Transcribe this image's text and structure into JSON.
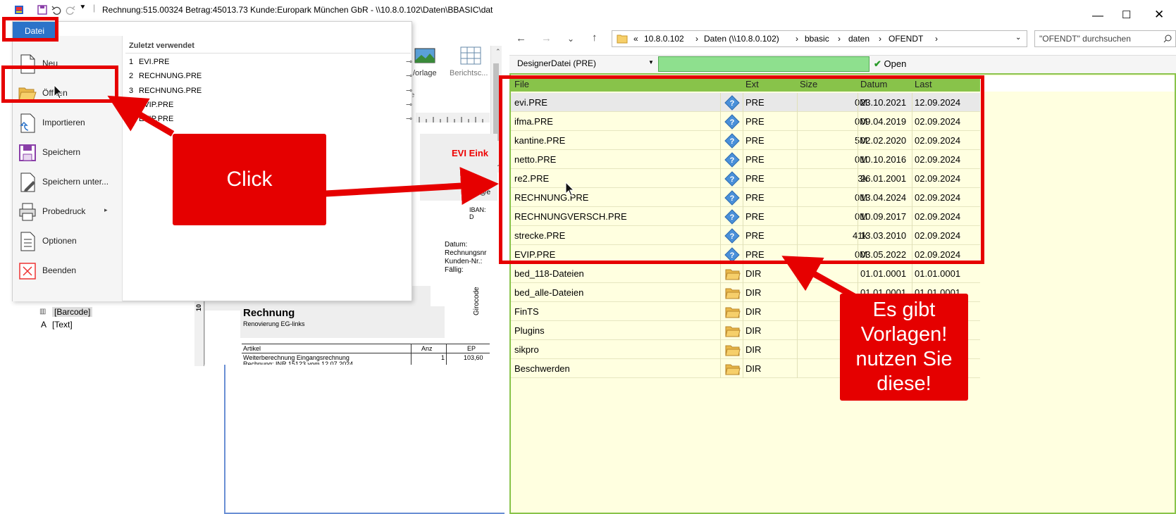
{
  "window": {
    "title": "Rechnung:515.00324 Betrag:45013.73 Kunde:Europark München GbR - \\\\10.8.0.102\\Daten\\BBASIC\\daten\\"
  },
  "ribbon": {
    "vorlage_label": "/orlage",
    "berichts_label": "Berichtsc..."
  },
  "background_doc": {
    "evi_header": "EVI Eink",
    "email_fragment": "il@e",
    "iban_fragment": "IBAN: D",
    "meta_labels": [
      "Datum:",
      "Rechnungsnr",
      "Kunden-Nr.:",
      "Fällig:"
    ],
    "invoice_title": "Rechnung",
    "invoice_subtitle": "Renovierung EG-links",
    "table_headers": [
      "Artikel",
      "Anz",
      "EP"
    ],
    "table_row": [
      "Weiterberechnung Eingangsrechnung",
      "1",
      "103,60"
    ],
    "table_row2": "Rechnung: INR 15123 vom 12.07.2024",
    "giro_label": "Girocode",
    "ruler_label": "10",
    "tree_items": [
      "[Barcode]",
      "[Text]"
    ],
    "tree_prefix": "A"
  },
  "file_menu": {
    "tab_label": "Datei",
    "items": [
      {
        "label": "Neu",
        "icon": "new-file-icon"
      },
      {
        "label": "Öffnen",
        "icon": "open-folder-icon"
      },
      {
        "label": "Importieren",
        "icon": "import-icon"
      },
      {
        "label": "Speichern",
        "icon": "save-icon"
      },
      {
        "label": "Speichern unter...",
        "icon": "save-as-icon"
      },
      {
        "label": "Probedruck",
        "icon": "printer-icon"
      },
      {
        "label": "Optionen",
        "icon": "options-icon"
      },
      {
        "label": "Beenden",
        "icon": "exit-icon"
      }
    ],
    "recent_header": "Zuletzt verwendet",
    "recent": [
      {
        "num": "1",
        "name": "EVI.PRE"
      },
      {
        "num": "2",
        "name": "RECHNUNG.PRE"
      },
      {
        "num": "3",
        "name": "RECHNUNG.PRE"
      },
      {
        "num": "4",
        "name": "EVIP.PRE"
      },
      {
        "num": "5",
        "name": "EVIP.PRE"
      }
    ]
  },
  "dialog": {
    "path": [
      "10.8.0.102",
      "Daten (\\\\10.8.0.102)",
      "bbasic",
      "daten",
      "OFENDT"
    ],
    "path_prefix": "«",
    "search_placeholder": "\"OFENDT\" durchsuchen",
    "filter_label": "DesignerDatei (PRE)",
    "filter_value": "",
    "open_label": "Open",
    "columns": [
      "File",
      "Ext",
      "Size",
      "Datum",
      "Last"
    ],
    "files": [
      {
        "name": "evi.PRE",
        "ext": "PRE",
        "size": "0M",
        "datum": "23.10.2021",
        "last": "12.09.2024",
        "type": "file"
      },
      {
        "name": "ifma.PRE",
        "ext": "PRE",
        "size": "0M",
        "datum": "09.04.2019",
        "last": "02.09.2024",
        "type": "file"
      },
      {
        "name": "kantine.PRE",
        "ext": "PRE",
        "size": "5M",
        "datum": "02.02.2020",
        "last": "02.09.2024",
        "type": "file"
      },
      {
        "name": "netto.PRE",
        "ext": "PRE",
        "size": "0M",
        "datum": "10.10.2016",
        "last": "02.09.2024",
        "type": "file"
      },
      {
        "name": "re2.PRE",
        "ext": "PRE",
        "size": "3k",
        "datum": "26.01.2001",
        "last": "02.09.2024",
        "type": "file"
      },
      {
        "name": "RECHNUNG.PRE",
        "ext": "PRE",
        "size": "0M",
        "datum": "13.04.2024",
        "last": "02.09.2024",
        "type": "file"
      },
      {
        "name": "RECHNUNGVERSCH.PRE",
        "ext": "PRE",
        "size": "0M",
        "datum": "10.09.2017",
        "last": "02.09.2024",
        "type": "file"
      },
      {
        "name": "strecke.PRE",
        "ext": "PRE",
        "size": "41k",
        "datum": "13.03.2010",
        "last": "02.09.2024",
        "type": "file"
      },
      {
        "name": "EVIP.PRE",
        "ext": "PRE",
        "size": "0M",
        "datum": "03.05.2022",
        "last": "02.09.2024",
        "type": "file"
      },
      {
        "name": "bed_118-Dateien",
        "ext": "DIR",
        "size": "",
        "datum": "01.01.0001",
        "last": "01.01.0001",
        "type": "dir"
      },
      {
        "name": "bed_alle-Dateien",
        "ext": "DIR",
        "size": "",
        "datum": "01.01.0001",
        "last": "01.01.0001",
        "type": "dir"
      },
      {
        "name": "FinTS",
        "ext": "DIR",
        "size": "",
        "datum": "",
        "last": "",
        "type": "dir"
      },
      {
        "name": "Plugins",
        "ext": "DIR",
        "size": "",
        "datum": "",
        "last": "",
        "type": "dir"
      },
      {
        "name": "sikpro",
        "ext": "DIR",
        "size": "",
        "datum": "",
        "last": "",
        "type": "dir"
      },
      {
        "name": "Beschwerden",
        "ext": "DIR",
        "size": "",
        "datum": "",
        "last": "",
        "type": "dir"
      }
    ]
  },
  "annotations": {
    "click_label": "Click",
    "hint_lines": [
      "Es gibt",
      "Vorlagen!",
      "nutzen Sie",
      "diese!"
    ],
    "accent": "#e60000"
  }
}
